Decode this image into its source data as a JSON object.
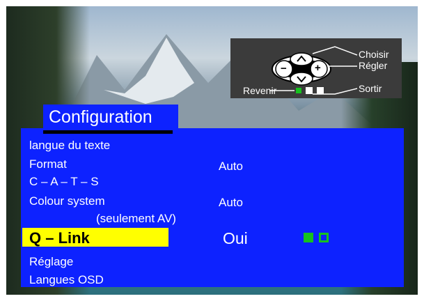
{
  "legend": {
    "choisir": "Choisir",
    "regler": "Régler",
    "revenir": "Revenir",
    "sortir": "Sortir",
    "minus_symbol": "−",
    "plus_symbol": "+",
    "button_colors": [
      "#16c21e",
      "#ffffff",
      "#ffffff"
    ]
  },
  "menu": {
    "title": "Configuration",
    "items": [
      {
        "label": "langue du texte",
        "value": ""
      },
      {
        "label": "Format",
        "value": "Auto"
      },
      {
        "label": "C – A – T – S",
        "value": ""
      },
      {
        "label": "Colour system",
        "value": "Auto"
      },
      {
        "label": "(seulement AV)",
        "value": ""
      },
      {
        "label": "Q – Link",
        "value": "Oui"
      },
      {
        "label": "Réglage",
        "value": ""
      },
      {
        "label": "Langues OSD",
        "value": ""
      }
    ],
    "selected_index": 5,
    "qlink_indicators": [
      "filled",
      "outline"
    ],
    "colors": {
      "panel": "#0d22ff",
      "highlight": "#ffff00",
      "indicator": "#16c21e"
    }
  }
}
